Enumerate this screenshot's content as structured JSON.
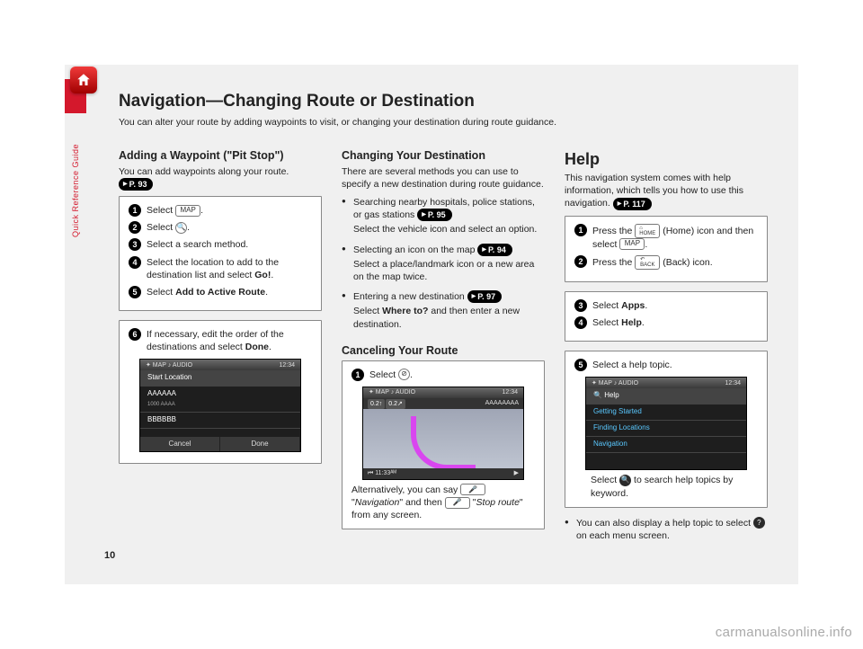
{
  "sideLabel": "Quick Reference Guide",
  "pageNumber": "10",
  "watermark": "carmanualsonline.info",
  "header": {
    "title": "Navigation—Changing Route or Destination",
    "subtitle": "You can alter your route by adding waypoints to visit, or changing your destination during route guidance."
  },
  "col1": {
    "h": "Adding a Waypoint (\"Pit Stop\")",
    "intro": "You can add waypoints along your route.",
    "ref": "P. 93",
    "steps1": {
      "s1a": "Select ",
      "s1chip": "MAP",
      "s1b": ".",
      "s2a": "Select ",
      "s2chip": "🔍",
      "s2b": ".",
      "s3": "Select a search method.",
      "s4a": "Select the location to add to the destination list and select ",
      "s4b": "Go!",
      "s4c": ".",
      "s5a": "Select ",
      "s5b": "Add to Active Route",
      "s5c": "."
    },
    "steps2": {
      "s6a": "If necessary, edit the order of the destinations and select ",
      "s6b": "Done",
      "s6c": "."
    },
    "shot1": {
      "barL": "✦ MAP  ♪ AUDIO",
      "barR": "12:34",
      "rowHead": "Start Location",
      "row1": "AAAAAA",
      "row1b": "1000 AAAA",
      "row2": "BBBBBB",
      "btnL": "Cancel",
      "btnR": "Done"
    }
  },
  "col2": {
    "h": "Changing Your Destination",
    "intro": "There are several methods you can use to specify a new destination during route guidance.",
    "b1a": "Searching nearby hospitals, police stations, or gas stations ",
    "b1ref": "P. 95",
    "b1sub": "Select the vehicle icon and select an option.",
    "b2a": "Selecting an icon on the map ",
    "b2ref": "P. 94",
    "b2sub": "Select a place/landmark icon or a new area on the map twice.",
    "b3a": "Entering a new destination ",
    "b3ref": "P. 97",
    "b3sub1": "Select ",
    "b3subBold": "Where to?",
    "b3sub2": " and then enter a new destination.",
    "h2": "Canceling Your Route",
    "cancel_step_a": "Select ",
    "cancel_step_chip": "⊘",
    "cancel_step_b": ".",
    "shot2": {
      "barL": "✦ MAP  ♪ AUDIO",
      "barR": "12:34",
      "tag1": "0.2↑",
      "tag2": "0.2↗",
      "dest": "AAAAAAAA",
      "botL": "⏮ 11:33ᴬᴹ",
      "botR": "▶"
    },
    "alt1": "Alternatively, you can say ",
    "altChip": "🎤",
    "alt2": " \"",
    "altI1": "Navigation",
    "alt3": "\" and then ",
    "alt4": " \"",
    "altI2": "Stop route",
    "alt5": "\" from any screen."
  },
  "col3": {
    "h": "Help",
    "intro": "This navigation system comes with help information, which tells you how to use this navigation. ",
    "ref": "P. 117",
    "boxA": {
      "s1a": "Press the ",
      "s1chip": "⌂\nHOME",
      "s1b": " (Home) icon and then select ",
      "s1chip2": "MAP",
      "s1c": ".",
      "s2a": "Press the ",
      "s2chip": "↶\nBACK",
      "s2b": " (Back) icon."
    },
    "boxB": {
      "s3a": "Select ",
      "s3b": "Apps",
      "s3c": ".",
      "s4a": "Select ",
      "s4b": "Help",
      "s4c": "."
    },
    "boxC": {
      "s5": "Select a help topic.",
      "shot": {
        "barL": "✦ MAP  ♪ AUDIO",
        "barR": "12:34",
        "head": "Help",
        "r1": "Getting Started",
        "r2": "Finding Locations",
        "r3": "Navigation"
      },
      "cap_a": "Select ",
      "cap_chip": "🔍",
      "cap_b": " to search help topics by keyword."
    },
    "bullet_a": "You can also display a help topic to select ",
    "bullet_chip": "?",
    "bullet_b": " on each menu screen."
  }
}
